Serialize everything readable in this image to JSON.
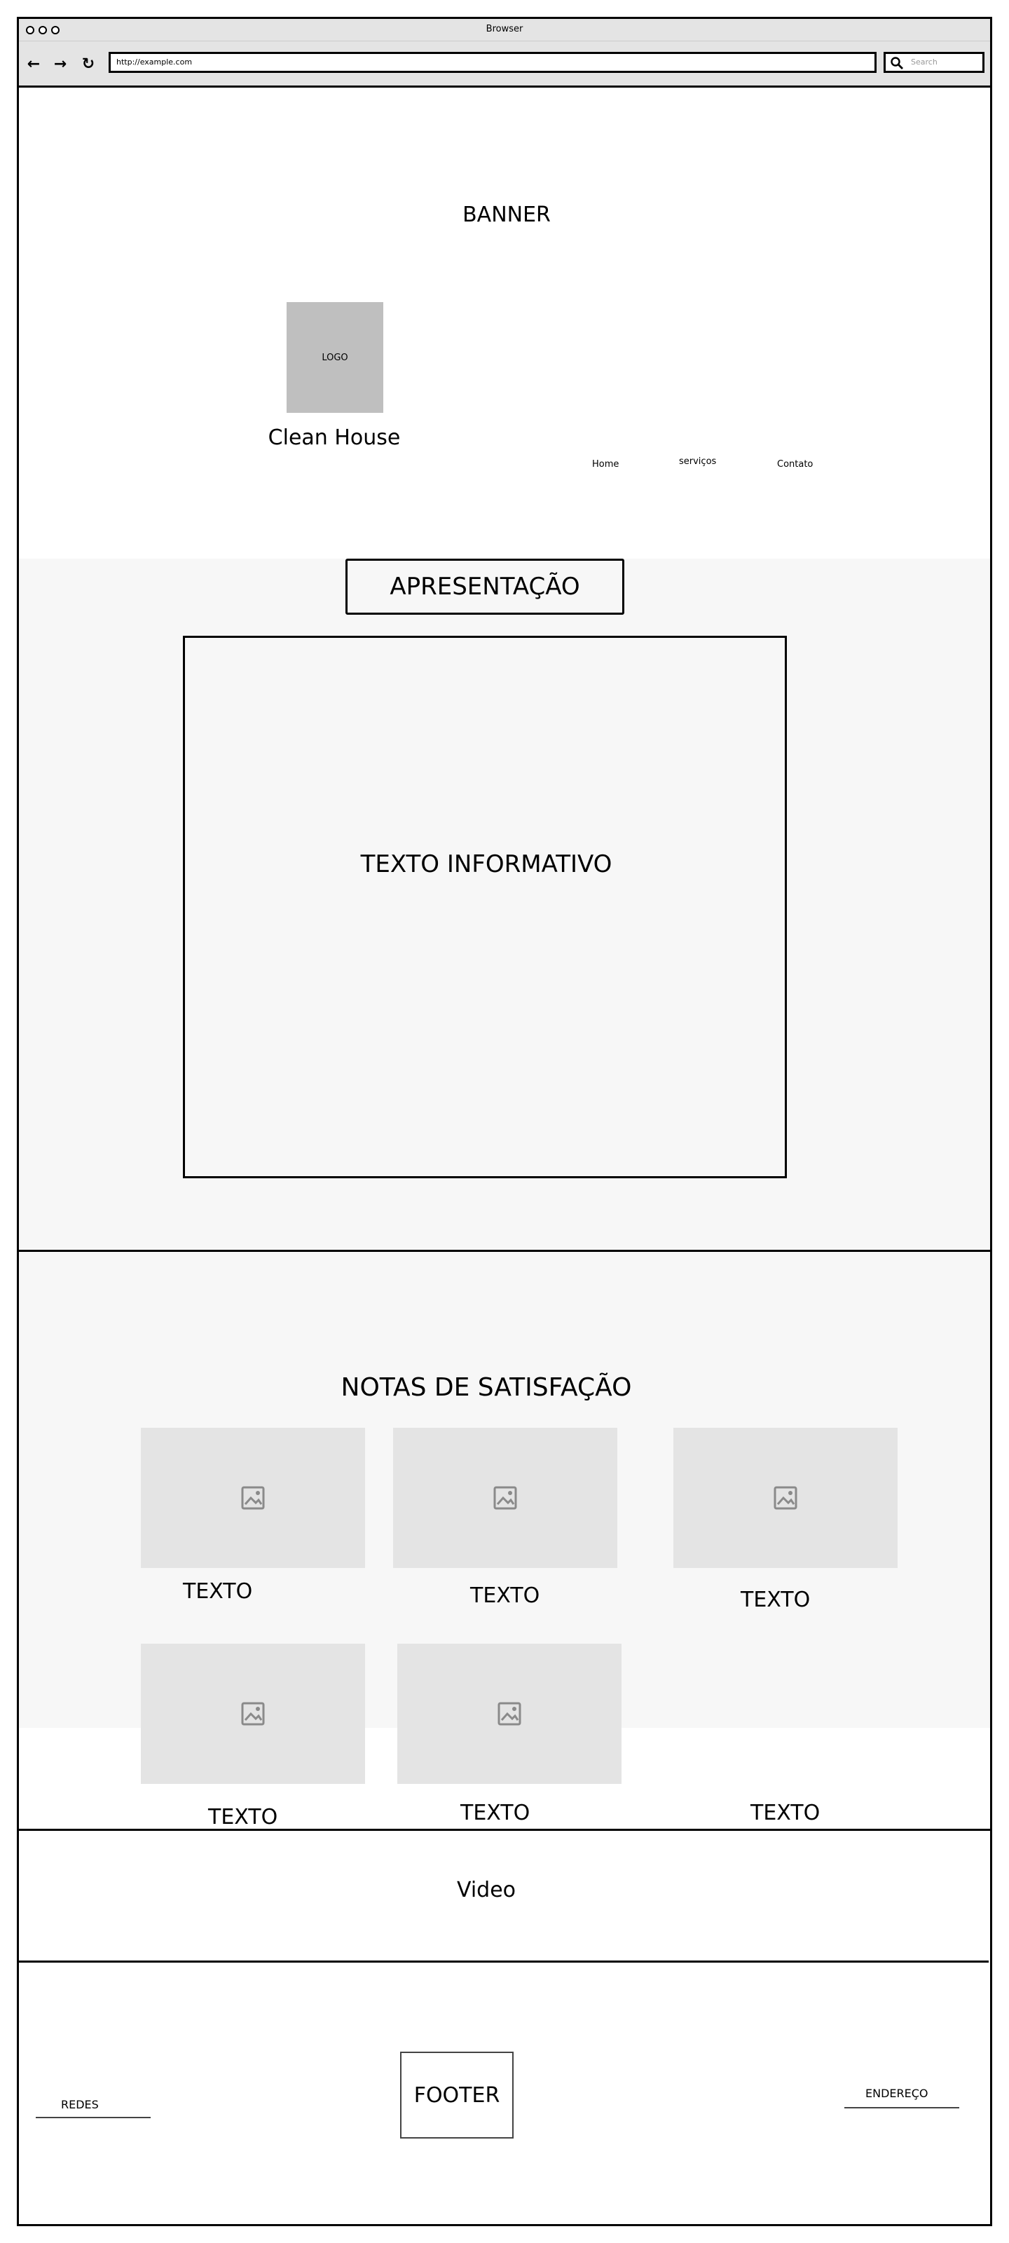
{
  "window": {
    "title": "Browser"
  },
  "toolbar": {
    "url": "http://example.com",
    "search_placeholder": "Search",
    "icons": [
      "back-icon",
      "forward-icon",
      "reload-icon",
      "search-icon"
    ]
  },
  "banner": {
    "title": "BANNER",
    "logo": "LOGO",
    "brand": "Clean House",
    "nav": [
      "Home",
      "serviços",
      "Contato"
    ]
  },
  "apresentacao": {
    "title": "APRESENTAÇÃO",
    "text": "TEXTO INFORMATIVO"
  },
  "notas": {
    "title": "NOTAS DE SATISFAÇÃO",
    "captions": [
      "TEXTO",
      "TEXTO",
      "TEXTO",
      "TEXTO",
      "TEXTO",
      "TEXTO"
    ]
  },
  "video": {
    "label": "Video"
  },
  "footer": {
    "left": "REDES",
    "center": "FOOTER",
    "right": "ENDEREÇO"
  },
  "colors": {
    "chrome": "#e4e4e4",
    "logo_fill": "#bfbfbf",
    "section_bg": "#f7f7f7",
    "image_placeholder": "#e4e4e4",
    "line": "#000000"
  }
}
